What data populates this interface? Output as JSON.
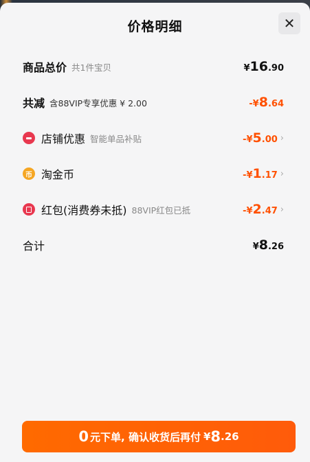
{
  "header": {
    "title": "价格明细",
    "close_icon": "close-icon"
  },
  "rows": {
    "total": {
      "label": "商品总价",
      "sub": "共1件宝贝",
      "sym": "¥",
      "int": "16",
      "dec": ".90"
    },
    "discount": {
      "label": "共减",
      "sub": "含88VIP专享优惠 ¥ 2.00",
      "sym": "-¥",
      "int": "8",
      "dec": ".64",
      "color": "#ff5000"
    },
    "shop": {
      "icon": "shop-coupon-icon",
      "label": "店铺优惠",
      "sub": "智能单品补贴",
      "sym": "-¥",
      "int": "5",
      "dec": ".00"
    },
    "coins": {
      "icon": "taojinbi-coin-icon",
      "icon_glyph": "币",
      "label": "淘金币",
      "sym": "-¥",
      "int": "1",
      "dec": ".17"
    },
    "redpacket": {
      "icon": "red-envelope-icon",
      "label": "红包(消费券未抵)",
      "sub": "88VIP红包已抵",
      "sym": "-¥",
      "int": "2",
      "dec": ".47"
    },
    "sum": {
      "label": "合计",
      "sym": "¥",
      "int": "8",
      "dec": ".26"
    }
  },
  "cta": {
    "big": "0",
    "text": "元下单, 确认收货后再付",
    "sym": "¥",
    "int": "8",
    "dec": ".26",
    "color": "#ff6a00"
  }
}
